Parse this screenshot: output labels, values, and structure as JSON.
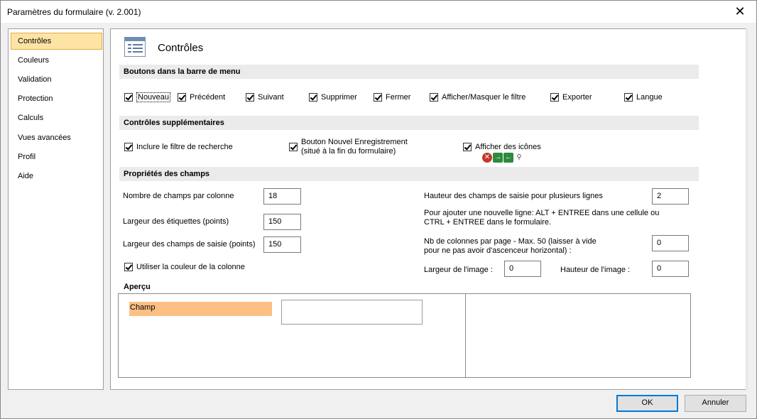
{
  "window": {
    "title": "Paramètres du formulaire (v. 2.001)",
    "close_symbol": "✕"
  },
  "sidebar": {
    "items": [
      {
        "label": "Contrôles",
        "active": true
      },
      {
        "label": "Couleurs"
      },
      {
        "label": "Validation"
      },
      {
        "label": "Protection"
      },
      {
        "label": "Calculs"
      },
      {
        "label": "Vues avancées"
      },
      {
        "label": "Profil"
      },
      {
        "label": "Aide"
      }
    ]
  },
  "header": {
    "title": "Contrôles",
    "icon": "form-layout-icon"
  },
  "sections": {
    "menu_buttons": "Boutons dans la barre de menu",
    "extra_controls": "Contrôles supplémentaires",
    "field_props": "Propriétés des champs",
    "preview": "Aperçu"
  },
  "menu_buttons": [
    {
      "label": "Nouveau",
      "checked": true
    },
    {
      "label": "Précédent",
      "checked": true
    },
    {
      "label": "Suivant",
      "checked": true
    },
    {
      "label": "Supprimer",
      "checked": true
    },
    {
      "label": "Fermer",
      "checked": true
    },
    {
      "label": "Afficher/Masquer le filtre",
      "checked": true
    },
    {
      "label": "Exporter",
      "checked": true
    },
    {
      "label": "Langue",
      "checked": true
    }
  ],
  "extra_controls": {
    "search_filter": {
      "label": "Inclure le filtre de recherche",
      "checked": true
    },
    "new_record_button": {
      "line1": "Bouton Nouvel Enregistrement",
      "line2": "(situé à la fin du formulaire)",
      "checked": true
    },
    "show_icons": {
      "label": "Afficher des icônes",
      "checked": true,
      "icons": [
        "delete-icon",
        "next-arrow-icon",
        "prev-arrow-icon",
        "filter-icon"
      ]
    }
  },
  "field_props": {
    "fields_per_column": {
      "label": "Nombre de champs par colonne",
      "value": "18"
    },
    "label_width": {
      "label": "Largeur des étiquettes (points)",
      "value": "150"
    },
    "input_width": {
      "label": "Largeur des champs de saisie (points)",
      "value": "150"
    },
    "use_column_color": {
      "label": "Utiliser la couleur de la colonne",
      "checked": true
    },
    "multiline_height": {
      "label": "Hauteur des champs de saisie pour plusieurs lignes",
      "value": "2"
    },
    "newline_hint_1": "Pour ajouter une nouvelle ligne: ALT + ENTREE dans une cellule ou",
    "newline_hint_2": "CTRL + ENTREE dans le formulaire.",
    "cols_per_page": {
      "line1": "Nb de colonnes par page - Max. 50 (laisser à vide",
      "line2": "pour ne pas avoir d'ascenceur horizontal) :",
      "value": "0"
    },
    "image_width": {
      "label": "Largeur de l'image :",
      "value": "0"
    },
    "image_height": {
      "label": "Hauteur de l'image :",
      "value": "0"
    }
  },
  "preview": {
    "field_label": "Champ",
    "label_color": "#fcbf84"
  },
  "footer": {
    "ok": "OK",
    "cancel": "Annuler"
  },
  "colors": {
    "active_nav": "#fde4a4",
    "section_bg": "#ebebeb",
    "accent": "#0078d7"
  }
}
